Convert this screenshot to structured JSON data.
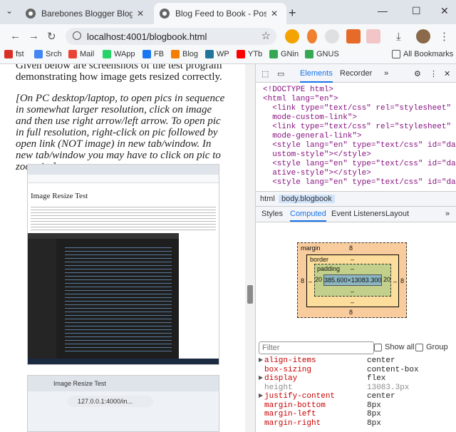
{
  "tabs": [
    {
      "title": "Barebones Blogger Blog Feed to",
      "active": false
    },
    {
      "title": "Blog Feed to Book - Posts Outp",
      "active": true
    }
  ],
  "toolbar": {
    "url": "localhost:4001/blogbook.html"
  },
  "bookmarks": [
    {
      "label": "fst",
      "color": "#d93025"
    },
    {
      "label": "Srch",
      "color": "#4285f4"
    },
    {
      "label": "Mail",
      "color": "#ea4335"
    },
    {
      "label": "WApp",
      "color": "#25d366"
    },
    {
      "label": "FB",
      "color": "#1877f2"
    },
    {
      "label": "Blog",
      "color": "#f57d00"
    },
    {
      "label": "WP",
      "color": "#21759b"
    },
    {
      "label": "YTb",
      "color": "#ff0000"
    },
    {
      "label": "GNin",
      "color": "#34a853"
    },
    {
      "label": "GNUS",
      "color": "#34a853"
    },
    {
      "label": "All Bookmarks",
      "color": "#555555"
    }
  ],
  "page": {
    "para1": "Given below are screenshots of the test program demonstrating how image gets resized correctly.",
    "para2": "[On PC desktop/laptop, to open pics in sequence in somewhat larger resolution, click on image and then use right arrow/left arrow. To open pic in full resolution, right-click on pic followed by open link (NOT image) in new tab/window. In new tab/window you may have to click on pic to zoom in.]",
    "shot1_title": "Image Resize Test",
    "shot2_title": "Image Resize Test",
    "shot2_url": "127.0.0.1:4000/in..."
  },
  "devtools": {
    "tabs": [
      "Elements",
      "Recorder"
    ],
    "dom_lines": [
      {
        "text": "<!DOCTYPE html>"
      },
      {
        "text": "<html lang=\"en\">"
      },
      {
        "text": "  <link type=\"text/css\" rel=\"stylesheet\" id=\"dark-"
      },
      {
        "text": "  mode-custom-link\">"
      },
      {
        "text": "  <link type=\"text/css\" rel=\"stylesheet\" id=\"dark-"
      },
      {
        "text": "  mode-general-link\">"
      },
      {
        "text": "  <style lang=\"en\" type=\"text/css\" id=\"dark-mode-c"
      },
      {
        "text": "  ustom-style\"></style>"
      },
      {
        "text": "  <style lang=\"en\" type=\"text/css\" id=\"dark-mode-n"
      },
      {
        "text": "  ative-style\"></style>"
      },
      {
        "text": "  <style lang=\"en\" type=\"text/css\" id=\"dark-mode-n"
      }
    ],
    "crumbs": [
      "html",
      "body.blogbook"
    ],
    "subtabs": [
      "Styles",
      "Computed",
      "Event Listeners",
      "Layout"
    ],
    "box": {
      "margin_label": "margin",
      "margin": "8",
      "margin_left": "8",
      "margin_right": "8",
      "margin_bottom": "8",
      "border_label": "border",
      "border": "–",
      "border_left": "–",
      "border_right": "–",
      "border_bottom": "–",
      "padding_label": "padding",
      "padding": "–",
      "padding_left": "20",
      "padding_right": "20",
      "padding_bottom": "–",
      "content": "385.600×13083.300"
    },
    "filter_placeholder": "Filter",
    "show_all": "Show all",
    "group": "Group",
    "properties": [
      {
        "name": "align-items",
        "value": "center",
        "expandable": true,
        "inherited": false
      },
      {
        "name": "box-sizing",
        "value": "content-box",
        "expandable": false,
        "inherited": false
      },
      {
        "name": "display",
        "value": "flex",
        "expandable": true,
        "inherited": false
      },
      {
        "name": "height",
        "value": "13083.3px",
        "expandable": false,
        "inherited": true
      },
      {
        "name": "justify-content",
        "value": "center",
        "expandable": true,
        "inherited": false
      },
      {
        "name": "margin-bottom",
        "value": "8px",
        "expandable": false,
        "inherited": false
      },
      {
        "name": "margin-left",
        "value": "8px",
        "expandable": false,
        "inherited": false
      },
      {
        "name": "margin-right",
        "value": "8px",
        "expandable": false,
        "inherited": false
      }
    ]
  }
}
